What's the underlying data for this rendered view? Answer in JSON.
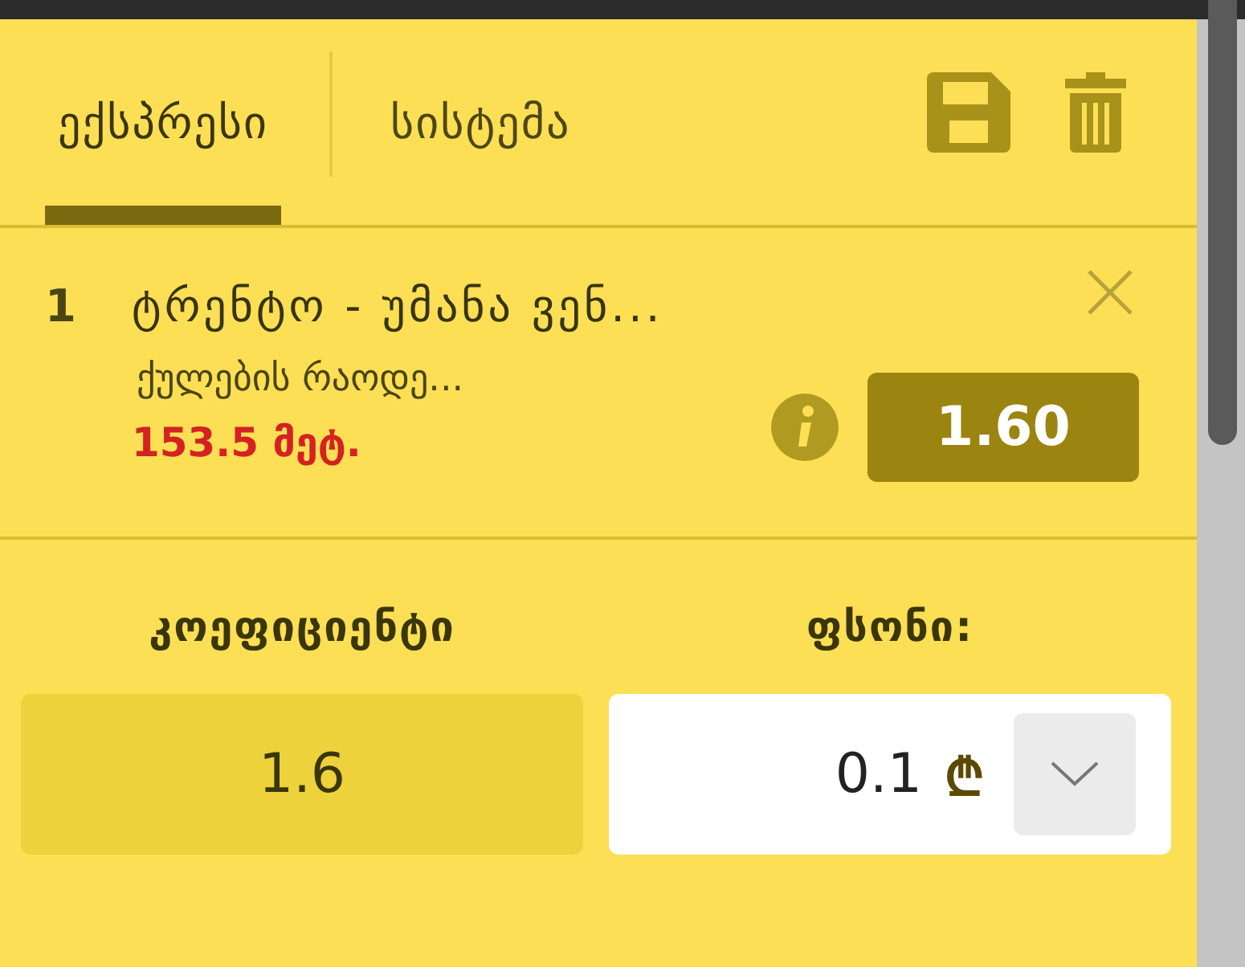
{
  "tabs": [
    {
      "label": "ექსპრესი",
      "selected": true
    },
    {
      "label": "სისტემა",
      "selected": false
    }
  ],
  "bet": {
    "number": "1",
    "title": "ტრენტო - უმანა ვენ...",
    "market": "ქულების რაოდე...",
    "selection": "153.5 მეტ.",
    "odds": "1.60"
  },
  "coefficient": {
    "label": "კოეფიციენტი",
    "value": "1.6"
  },
  "stake": {
    "label": "ფსონი:",
    "value": "0.1",
    "currency": "₾"
  }
}
